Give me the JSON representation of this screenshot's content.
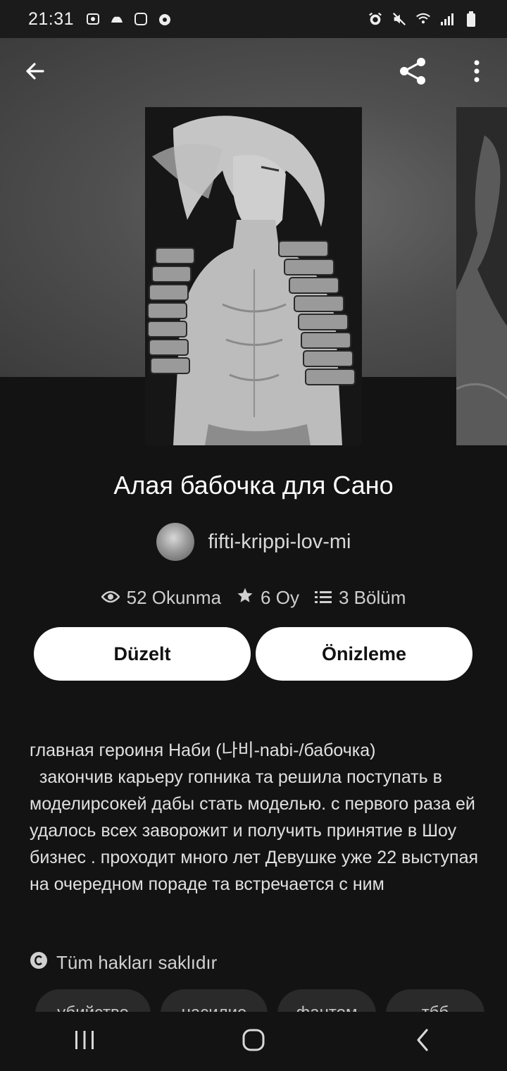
{
  "status_bar": {
    "time": "21:31",
    "left_icons": [
      "ig-bunny-icon",
      "game-icon",
      "square-icon",
      "pawprint-icon"
    ],
    "right_icons": [
      "alarm-icon",
      "mute-icon",
      "wifi-icon",
      "signal-icon",
      "battery-icon"
    ]
  },
  "header": {
    "back_icon": "arrow-left-icon",
    "share_icon": "share-icon",
    "menu_icon": "more-vert-icon"
  },
  "story": {
    "title": "Алая бабочка для Сано",
    "author": "fifti-krippi-lov-mi",
    "stats": {
      "reads": "52 Okunma",
      "votes": "6 Oy",
      "parts": "3 Bölüm"
    },
    "buttons": {
      "edit": "Düzelt",
      "preview": "Önizleme"
    },
    "description": "главная героиня Наби (나비-nabi-/бабочка)\n  закончив карьеру гопника та решила поступать в моделирсокей дабы стать моделью. с первого раза ей удалось всех заворожит и получить принятие в Шоу бизнес . проходит много лет Девушке уже 22 выступая на очередном пораде та встречается с ним",
    "rights": "Tüm hakları saklıdır",
    "tags": [
      "убийство",
      "насилие",
      "фантом",
      "тбб"
    ]
  },
  "nav_bar": {
    "recents_icon": "recents-icon",
    "home_icon": "home-icon",
    "back_icon": "back-chevron-icon"
  }
}
